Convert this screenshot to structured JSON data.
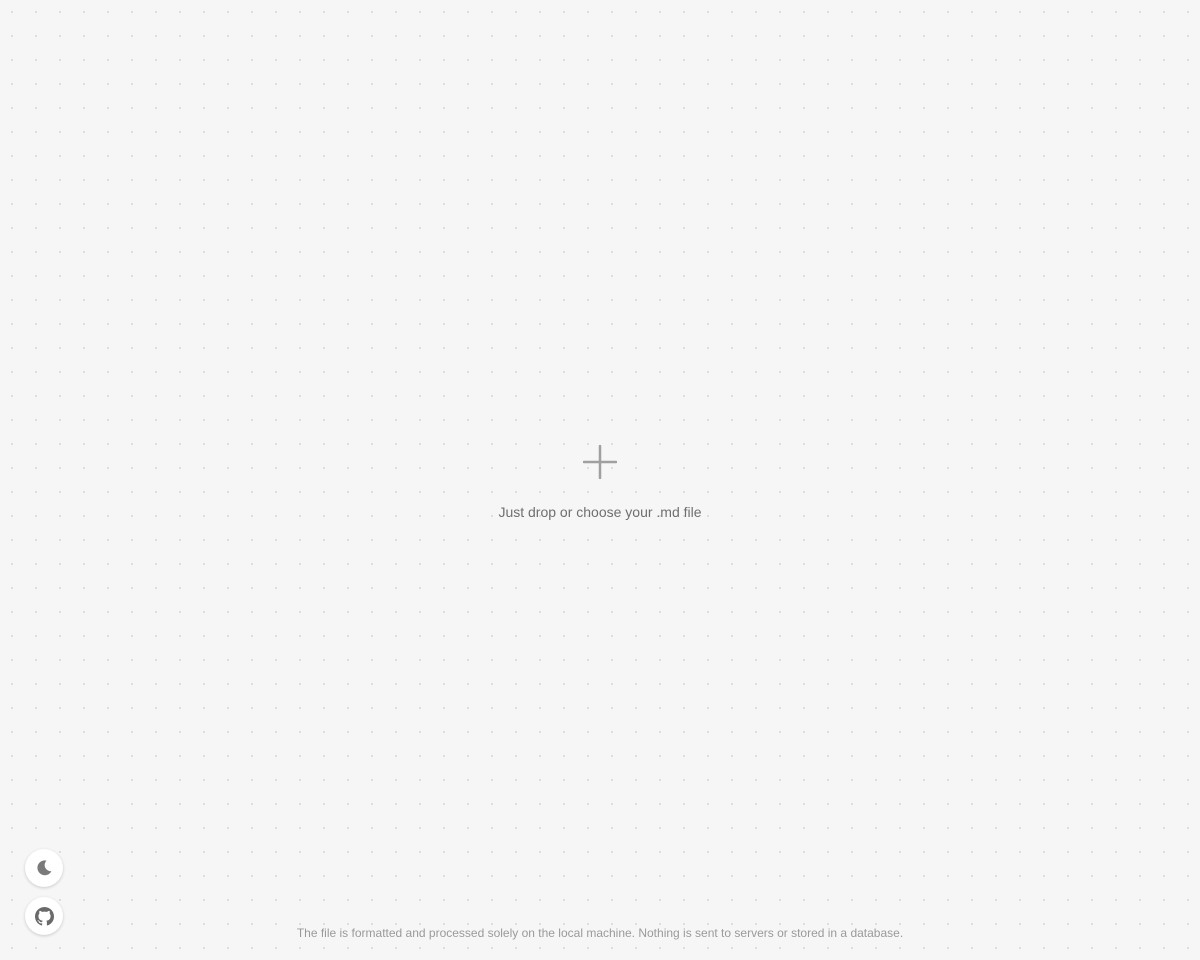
{
  "dropzone": {
    "label": "Just drop or choose your .md file",
    "icon": "plus-icon"
  },
  "controls": {
    "theme_toggle_icon": "moon-icon",
    "github_link_icon": "github-icon"
  },
  "footer": {
    "note": "The file is formatted and processed solely on the local machine. Nothing is sent to servers or stored in a database."
  },
  "colors": {
    "background": "#f6f6f6",
    "dot": "#d9d9d9",
    "icon": "#a0a0a0",
    "text": "#6f6f6f",
    "footer_text": "#9a9a9a"
  }
}
